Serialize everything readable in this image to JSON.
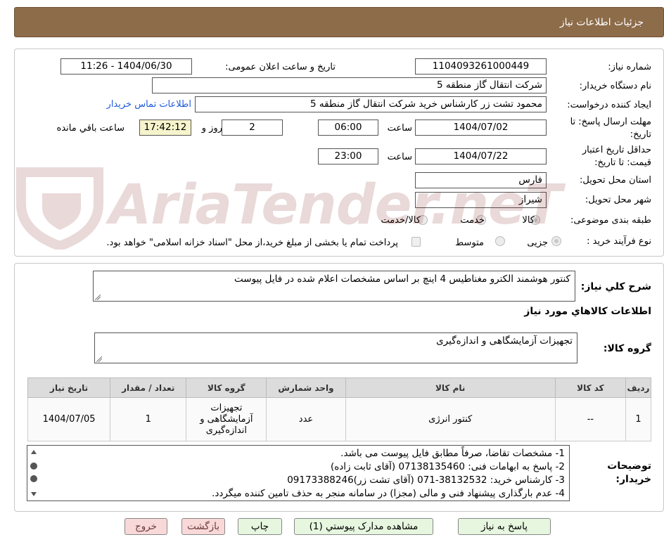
{
  "header": {
    "title": "جزئیات اطلاعات نیاز"
  },
  "form": {
    "need_number_label": "شماره نیاز:",
    "need_number": "1104093261000449",
    "announce_label": "تاریخ و ساعت اعلان عمومی:",
    "announce_value": "1404/06/30 - 11:26",
    "buyer_org_label": "نام دستگاه خریدار:",
    "buyer_org": "شرکت انتقال گاز منطقه 5",
    "creator_label": "ایجاد کننده درخواست:",
    "creator": "محمود تشت زر کارشناس خرید شرکت انتقال گاز منطقه 5",
    "contact_link": "اطلاعات تماس خریدار",
    "deadline_label_line1": "مهلت ارسال پاسخ: تا",
    "deadline_label_line2": "تاریخ:",
    "deadline_date": "1404/07/02",
    "time_label": "ساعت",
    "deadline_time": "06:00",
    "days_value": "2",
    "days_label": "روز و",
    "remaining_time": "17:42:12",
    "remaining_label": "ساعت باقي مانده",
    "validity_label_line1": "حداقل تاریخ اعتبار",
    "validity_label_line2": "قیمت: تا تاریخ:",
    "validity_date": "1404/07/22",
    "validity_time_label": "ساعت",
    "validity_time": "23:00",
    "province_label": "استان محل تحویل:",
    "province": "فارس",
    "city_label": "شهر محل تحویل:",
    "city": "شیراز",
    "category_label": "طبقه بندی موضوعی:",
    "category_options": [
      "کالا",
      "خدمت",
      "کالا/خدمت"
    ],
    "process_label": "نوع فرآیند خرید :",
    "process_options": [
      "جزیی",
      "متوسط"
    ],
    "payment_note": "پرداخت تمام یا بخشی از مبلغ خرید،از محل \"اسناد خزانه اسلامی\" خواهد بود."
  },
  "details": {
    "summary_label": "شرح کلي نیاز:",
    "summary": "کنتور هوشمند الکترو مغناطیس 4 اینچ بر اساس مشخصات اعلام شده در فایل پیوست",
    "goods_info_title": "اطلاعات کالاهاي مورد نیاز",
    "goods_group_label": "گروه کالا:",
    "goods_group": "تجهیزات آزمایشگاهی و اندازه‌گیری",
    "table": {
      "headers": [
        "ردیف",
        "کد کالا",
        "نام کالا",
        "واحد شمارش",
        "گروه کالا",
        "تعداد / مقدار",
        "تاریخ نیاز"
      ],
      "rows": [
        [
          "1",
          "--",
          "کنتور انرژی",
          "عدد",
          "تجهیزات آزمایشگاهی و اندازه‌گیری",
          "1",
          "1404/07/05"
        ]
      ]
    },
    "buyer_notes_label_line1": "توضیحات",
    "buyer_notes_label_line2": "خریدار:",
    "buyer_notes": [
      "1-  مشخصات تقاضا، صرفاً مطابق فایل پیوست می باشد.",
      "2- پاسخ به ابهامات فنی: 07138135460 (آقای ثابت زاده)",
      "3- کارشناس خرید: 38132532-071 (آقای تشت زر)09173388246",
      "4- عدم بارگذاری پیشنهاد فنی و مالی (مجزا) در سامانه منجر به حذف تامین کننده میگردد."
    ]
  },
  "buttons": {
    "reply": "پاسخ به نیاز",
    "attachments": "مشاهده مدارک پیوستي (1)",
    "print": "چاپ",
    "back": "بازگشت",
    "exit": "خروج"
  },
  "watermark": {
    "text": "AriaTender.neT"
  },
  "colors": {
    "header_bg": "#8d6c4a",
    "link": "#1f5ad8",
    "button_green": "#e6f6df",
    "button_pink": "#f8d8d8",
    "timer_bg": "#f6f4cc"
  }
}
